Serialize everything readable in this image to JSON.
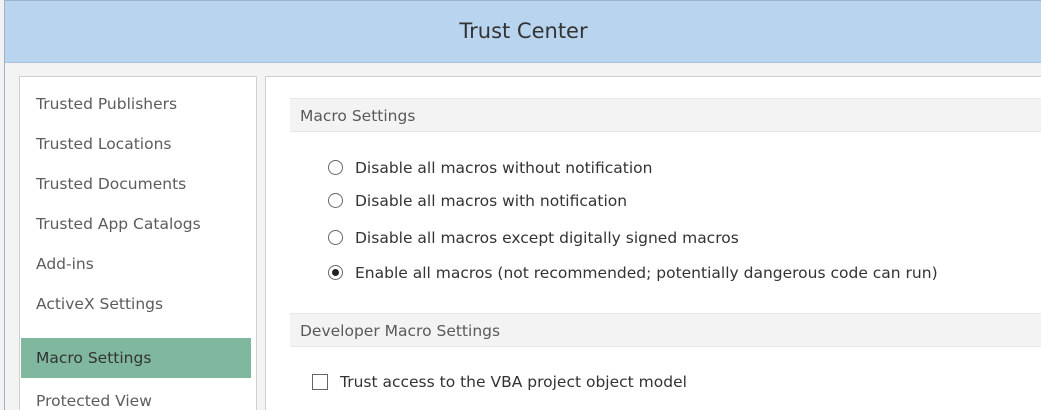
{
  "window": {
    "title": "Trust Center"
  },
  "sidebar": {
    "items": [
      {
        "label": "Trusted Publishers",
        "selected": false
      },
      {
        "label": "Trusted Locations",
        "selected": false
      },
      {
        "label": "Trusted Documents",
        "selected": false
      },
      {
        "label": "Trusted App Catalogs",
        "selected": false
      },
      {
        "label": "Add-ins",
        "selected": false
      },
      {
        "label": "ActiveX Settings",
        "selected": false
      },
      {
        "label": "Macro Settings",
        "selected": true
      },
      {
        "label": "Protected View",
        "selected": false
      }
    ]
  },
  "macro_settings": {
    "header": "Macro Settings",
    "options": [
      {
        "label": "Disable all macros without notification",
        "checked": false
      },
      {
        "label": "Disable all macros with notification",
        "checked": false
      },
      {
        "label": "Disable all macros except digitally signed macros",
        "checked": false
      },
      {
        "label": "Enable all macros (not recommended; potentially dangerous code can run)",
        "checked": true
      }
    ]
  },
  "developer_macro_settings": {
    "header": "Developer Macro Settings",
    "trust_vba": {
      "label": "Trust access to the VBA project object model",
      "checked": false
    }
  },
  "colors": {
    "titlebar": "#b9d4ee",
    "selected_item": "#7fb79f",
    "section_header_bg": "#f3f3f3"
  }
}
